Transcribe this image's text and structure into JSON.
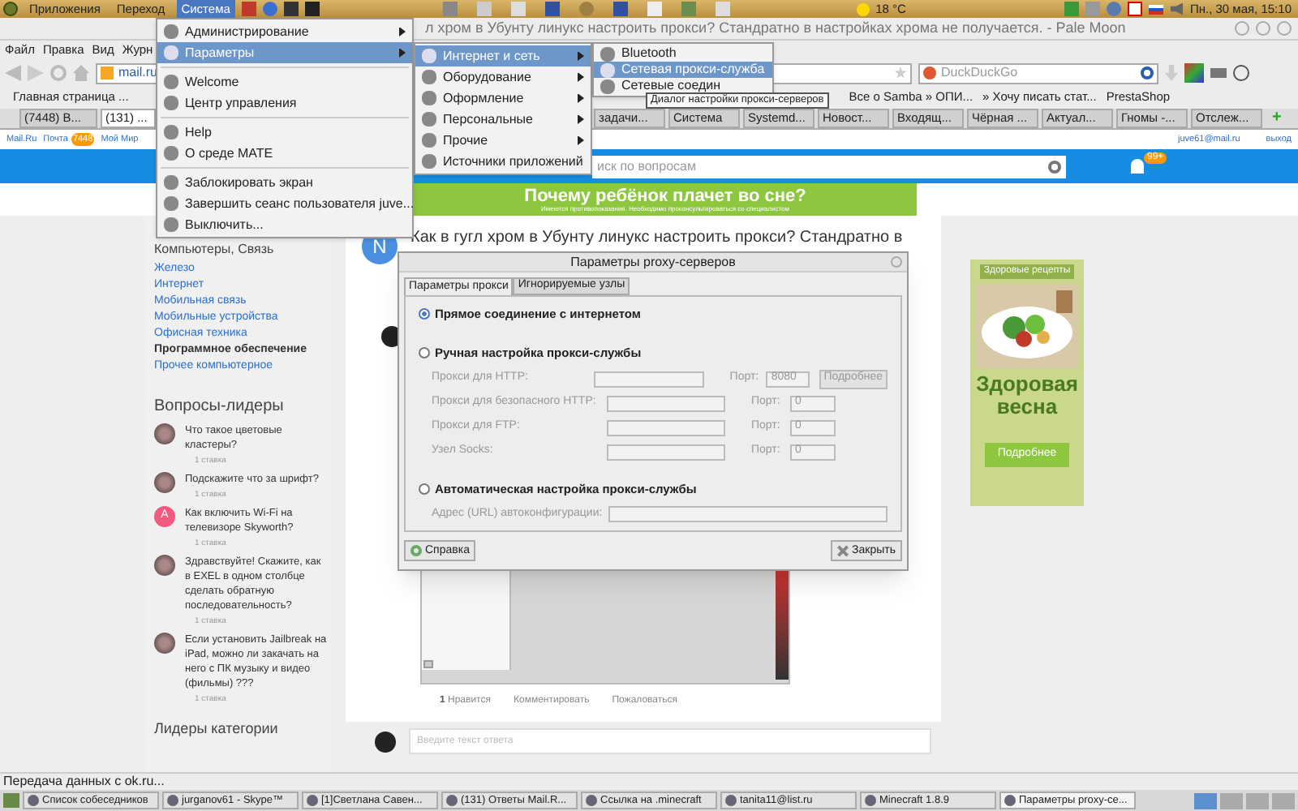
{
  "top_panel": {
    "menus": [
      {
        "label": "Приложения",
        "selected": false
      },
      {
        "label": "Переход",
        "selected": false
      },
      {
        "label": "Система",
        "selected": true
      }
    ],
    "weather": "18 °C",
    "clock": "Пн., 30 мая, 15:10"
  },
  "browser": {
    "title": "л хром в Убунту линукс настроить прокси? Стандратно в настройках хрома не получается. - Pale Moon",
    "menubar": [
      "Файл",
      "Правка",
      "Вид",
      "Журн"
    ],
    "address": "mail.ru",
    "search_placeholder": "DuckDuckGo",
    "bookmarks": [
      "Главная страница ...",
      "Все о Samba » ОПИ...",
      "» Хочу писать стат...",
      "PrestaShop"
    ],
    "tabs": [
      {
        "label": "(7448) В...",
        "selected": false
      },
      {
        "label": "(131) ...",
        "selected": true
      },
      {
        "label": "задачи...",
        "selected": false
      },
      {
        "label": "Система",
        "selected": false
      },
      {
        "label": "Systemd...",
        "selected": false
      },
      {
        "label": "Новост...",
        "selected": false
      },
      {
        "label": "Входящ...",
        "selected": false
      },
      {
        "label": "Чёрная ...",
        "selected": false
      },
      {
        "label": "Актуал...",
        "selected": false
      },
      {
        "label": "Гномы -...",
        "selected": false
      },
      {
        "label": "Отслеж...",
        "selected": false
      }
    ],
    "status": "Передача данных с ok.ru..."
  },
  "new_tab": "+",
  "page": {
    "header_links": [
      {
        "label": "Mail.Ru"
      },
      {
        "label": "Почта",
        "badge": "7448"
      },
      {
        "label": "Мой Мир"
      }
    ],
    "user": "juve61@mail.ru",
    "logout": "выход",
    "search_placeholder": "иск по вопросам",
    "notifications": "99+",
    "banner": {
      "title": "Почему ребёнок плачет во сне?",
      "note": "Имеются противопоказания. Необходимо проконсультироваться со специалистом"
    },
    "category_heading": "Компьютеры, Связь",
    "categories": [
      {
        "label": "Железо",
        "selected": false
      },
      {
        "label": "Интернет",
        "selected": false
      },
      {
        "label": "Мобильная связь",
        "selected": false
      },
      {
        "label": "Мобильные устройства",
        "selected": false
      },
      {
        "label": "Офисная техника",
        "selected": false
      },
      {
        "label": "Программное обеспечение",
        "selected": true
      },
      {
        "label": "Прочее компьютерное",
        "selected": false
      }
    ],
    "leaders_heading": "Вопросы-лидеры",
    "leader_questions": [
      {
        "text": "Что такое цветовые кластеры?",
        "bets": "1 ставка"
      },
      {
        "text": "Подскажите что за шрифт?",
        "bets": "1 ставка"
      },
      {
        "text": "Как включить Wi-Fi на телевизоре Skyworth?",
        "bets": "1 ставка",
        "kind": "letter",
        "letter": "A"
      },
      {
        "text": "Здравствуйте! Скажите, как в EXEL в одном столбце сделать обратную последовательность?",
        "bets": "1 ставка"
      },
      {
        "text": "Если установить Jailbreak на iPad, можно ли закачать на него с ПК музыку и видео (фильмы) ???",
        "bets": "1 ставка"
      }
    ],
    "category_leaders_heading": "Лидеры категории",
    "question": {
      "avatar_letter": "N",
      "title": "Как в гугл хром в Убунту линукс настроить прокси? Стандратно в",
      "likes": "1",
      "like_label": "Нравится",
      "comment": "Комментировать",
      "report": "Пожаловаться",
      "answer_placeholder": "Введите текст ответа"
    },
    "ad": {
      "title": "Здоровые рецепты",
      "headline": "Здоровая весна",
      "button": "Подробнее"
    }
  },
  "system_menu": [
    {
      "kind": "submenu",
      "label": "Администрирование",
      "selected": false
    },
    {
      "kind": "submenu",
      "label": "Параметры",
      "selected": true
    },
    {
      "kind": "separator"
    },
    {
      "kind": "item",
      "label": "Welcome",
      "selected": false
    },
    {
      "kind": "item",
      "label": "Центр управления",
      "selected": false
    },
    {
      "kind": "separator"
    },
    {
      "kind": "item",
      "label": "Help",
      "selected": false
    },
    {
      "kind": "item",
      "label": "О среде MATE",
      "selected": false
    },
    {
      "kind": "separator"
    },
    {
      "kind": "item",
      "label": "Заблокировать экран",
      "selected": false
    },
    {
      "kind": "item",
      "label": "Завершить сеанс пользователя juve...",
      "selected": false
    },
    {
      "kind": "item",
      "label": "Выключить...",
      "selected": false
    }
  ],
  "settings_menu": [
    {
      "kind": "submenu",
      "label": "Интернет и сеть",
      "selected": true
    },
    {
      "kind": "submenu",
      "label": "Оборудование",
      "selected": false
    },
    {
      "kind": "submenu",
      "label": "Оформление",
      "selected": false
    },
    {
      "kind": "submenu",
      "label": "Персональные",
      "selected": false
    },
    {
      "kind": "submenu",
      "label": "Прочие",
      "selected": false
    },
    {
      "kind": "item",
      "label": "Источники приложений",
      "selected": false
    }
  ],
  "network_menu": [
    {
      "label": "Bluetooth",
      "selected": false
    },
    {
      "label": "Сетевая прокси-служба",
      "selected": true
    },
    {
      "label": "Сетевые соедин",
      "selected": false
    }
  ],
  "tooltip": "Диалог настройки прокси-серверов",
  "dialog": {
    "title": "Параметры proxy-серверов",
    "tabs": [
      {
        "label": "Параметры прокси",
        "selected": true
      },
      {
        "label": "Игнорируемые узлы",
        "selected": false
      }
    ],
    "direct": {
      "label": "Прямое соединение с интернетом",
      "selected": true
    },
    "manual": {
      "label": "Ручная настройка прокси-службы",
      "selected": false
    },
    "proxies": [
      {
        "label": "Прокси для HTTP:",
        "port_label": "Порт:",
        "port": "8080"
      },
      {
        "label": "Прокси для безопасного HTTP:",
        "port_label": "Порт:",
        "port": "0"
      },
      {
        "label": "Прокси для FTP:",
        "port_label": "Порт:",
        "port": "0"
      },
      {
        "label": "Узел Socks:",
        "port_label": "Порт:",
        "port": "0"
      }
    ],
    "details": "Подробнее",
    "auto": {
      "label": "Автоматическая настройка прокси-службы",
      "selected": false
    },
    "auto_url_label": "Адрес (URL) автоконфигурации:",
    "help": "Справка",
    "close": "Закрыть"
  },
  "taskbar": [
    {
      "label": "Список собеседников",
      "selected": false
    },
    {
      "label": "jurganov61 - Skype™",
      "selected": false
    },
    {
      "label": "[1]Светлана Савен...",
      "selected": false
    },
    {
      "label": "(131) Ответы Mail.R...",
      "selected": false
    },
    {
      "label": "Ссылка на .minecraft",
      "selected": false
    },
    {
      "label": "tanita11@list.ru",
      "selected": false
    },
    {
      "label": "Minecraft 1.8.9",
      "selected": false
    },
    {
      "label": "Параметры proxy-се...",
      "selected": true
    }
  ]
}
